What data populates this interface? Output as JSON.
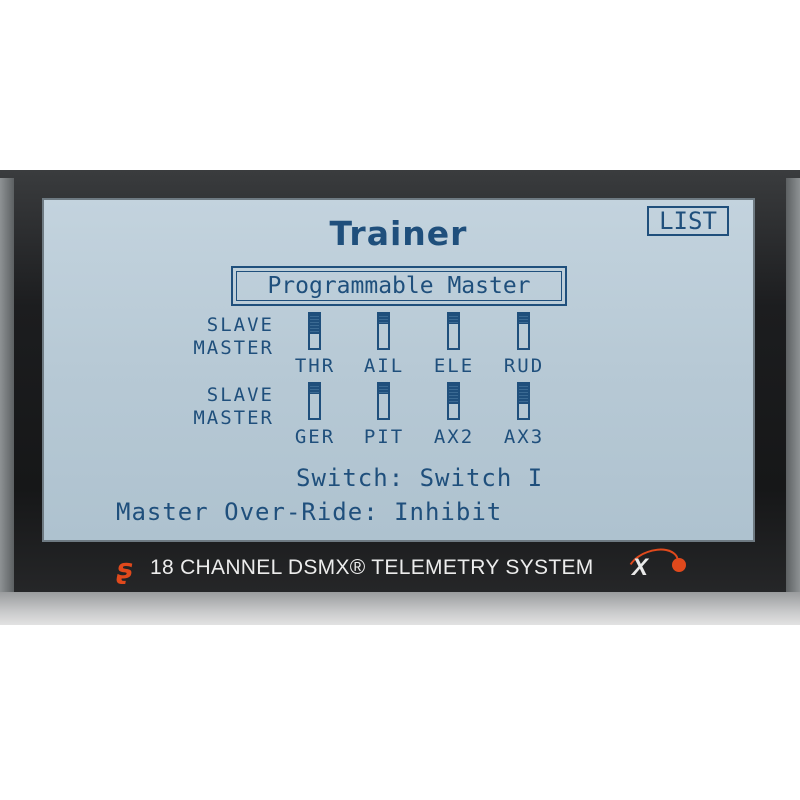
{
  "screen": {
    "title": "Trainer",
    "list_button": "LIST",
    "mode": "Programmable Master"
  },
  "labels": {
    "slave": "SLAVE",
    "master": "MASTER"
  },
  "channel_rows": [
    {
      "channels": [
        {
          "label": "THR",
          "slave_fraction": 0.6
        },
        {
          "label": "AIL",
          "slave_fraction": 0.3
        },
        {
          "label": "ELE",
          "slave_fraction": 0.3
        },
        {
          "label": "RUD",
          "slave_fraction": 0.3
        }
      ]
    },
    {
      "channels": [
        {
          "label": "GER",
          "slave_fraction": 0.3
        },
        {
          "label": "PIT",
          "slave_fraction": 0.3
        },
        {
          "label": "AX2",
          "slave_fraction": 0.6
        },
        {
          "label": "AX3",
          "slave_fraction": 0.6
        }
      ]
    }
  ],
  "switch_line": "Switch: Switch I",
  "override_line": "Master Over-Ride: Inhibit",
  "footer": {
    "brand_text": "18 CHANNEL DSMX® TELEMETRY SYSTEM",
    "logo_mark": "X+"
  },
  "colors": {
    "lcd_text": "#1f4f7c",
    "lcd_background": "#b7c9d5",
    "accent": "#e0491c"
  }
}
